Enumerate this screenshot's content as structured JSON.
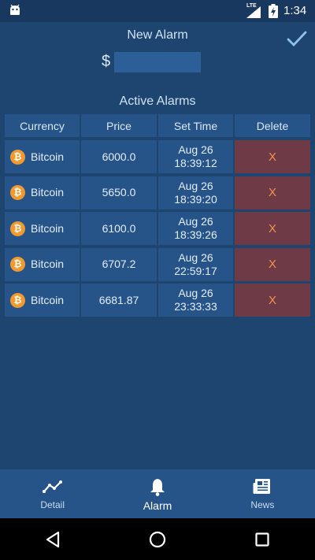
{
  "status_bar": {
    "time": "1:34",
    "network": "LTE"
  },
  "header": {
    "title": "New Alarm",
    "confirm_icon": "check-icon"
  },
  "new_alarm": {
    "currency_symbol": "$",
    "amount_value": "",
    "amount_placeholder": ""
  },
  "active_alarms": {
    "title": "Active Alarms",
    "columns": [
      "Currency",
      "Price",
      "Set Time",
      "Delete"
    ],
    "rows": [
      {
        "currency": "Bitcoin",
        "price": "6000.0",
        "date": "Aug 26",
        "time": "18:39:12",
        "delete_label": "X"
      },
      {
        "currency": "Bitcoin",
        "price": "5650.0",
        "date": "Aug 26",
        "time": "18:39:20",
        "delete_label": "X"
      },
      {
        "currency": "Bitcoin",
        "price": "6100.0",
        "date": "Aug 26",
        "time": "18:39:26",
        "delete_label": "X"
      },
      {
        "currency": "Bitcoin",
        "price": "6707.2",
        "date": "Aug 26",
        "time": "22:59:17",
        "delete_label": "X"
      },
      {
        "currency": "Bitcoin",
        "price": "6681.87",
        "date": "Aug 26",
        "time": "23:33:33",
        "delete_label": "X"
      }
    ]
  },
  "bottom_nav": {
    "items": [
      {
        "label": "Detail",
        "icon": "chart-line-icon",
        "active": false
      },
      {
        "label": "Alarm",
        "icon": "bell-icon",
        "active": true
      },
      {
        "label": "News",
        "icon": "newspaper-icon",
        "active": false
      }
    ]
  },
  "colors": {
    "background": "#1e4470",
    "cell": "#265489",
    "delete_cell": "#6e3a45",
    "delete_text": "#f4924e",
    "bitcoin": "#f29a2f"
  }
}
